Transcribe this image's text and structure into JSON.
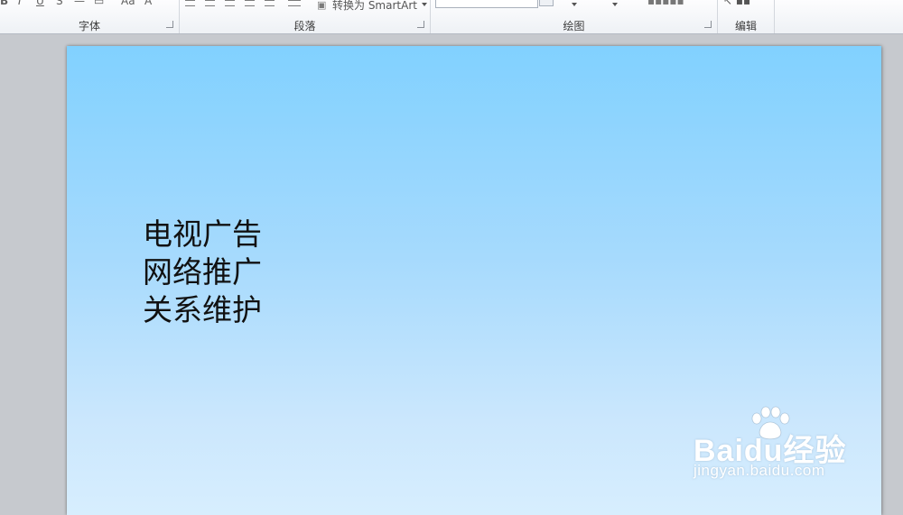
{
  "ribbon": {
    "groups": {
      "font": "字体",
      "paragraph": "段落",
      "drawing": "绘图",
      "editing": "编辑"
    },
    "convert_smartart": "转换为 SmartArt"
  },
  "slide": {
    "lines": [
      "电视广告",
      "网络推广",
      "关系维护"
    ]
  },
  "watermark": {
    "logo_text": "Baidu经验",
    "url": "jingyan.baidu.com"
  },
  "colors": {
    "slide_top": "#81d1ff",
    "slide_bottom": "#d7eefe",
    "workspace": "#c6c9ce"
  }
}
